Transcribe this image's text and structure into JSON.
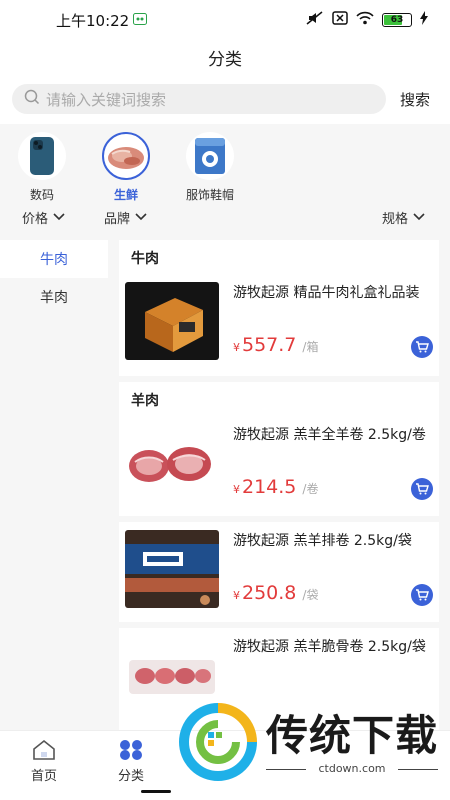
{
  "status_bar": {
    "time": "上午10:22",
    "battery": "63"
  },
  "header": {
    "title": "分类"
  },
  "search": {
    "placeholder": "请输入关键词搜索",
    "button_label": "搜索"
  },
  "categories": [
    {
      "label": "数码",
      "icon": "phone-icon",
      "active": false
    },
    {
      "label": "生鲜",
      "icon": "meat-icon",
      "active": true
    },
    {
      "label": "服饰鞋帽",
      "icon": "box-icon",
      "active": false
    }
  ],
  "filters": {
    "price": "价格",
    "brand": "品牌",
    "spec": "规格"
  },
  "sidebar": {
    "items": [
      {
        "label": "牛肉",
        "active": true
      },
      {
        "label": "羊肉",
        "active": false
      }
    ]
  },
  "sections": [
    {
      "title": "牛肉",
      "products": [
        {
          "name": "游牧起源 精品牛肉礼盒礼品装",
          "price": "557.7",
          "unit": "/箱"
        }
      ]
    },
    {
      "title": "羊肉",
      "products": [
        {
          "name": "游牧起源 羔羊全羊卷 2.5kg/卷",
          "price": "214.5",
          "unit": "/卷"
        },
        {
          "name": "游牧起源 羔羊排卷 2.5kg/袋",
          "price": "250.8",
          "unit": "/袋"
        },
        {
          "name": "游牧起源 羔羊脆骨卷 2.5kg/袋",
          "price": "",
          "unit": ""
        }
      ]
    }
  ],
  "currency_symbol": "¥",
  "tabbar": {
    "items": [
      {
        "label": "首页"
      },
      {
        "label": "分类"
      }
    ]
  },
  "watermark": {
    "text": "传统下载",
    "url": "ctdown.com"
  },
  "colors": {
    "accent": "#3b62d8",
    "price": "#e23b3b",
    "background": "#f6f6f6"
  }
}
